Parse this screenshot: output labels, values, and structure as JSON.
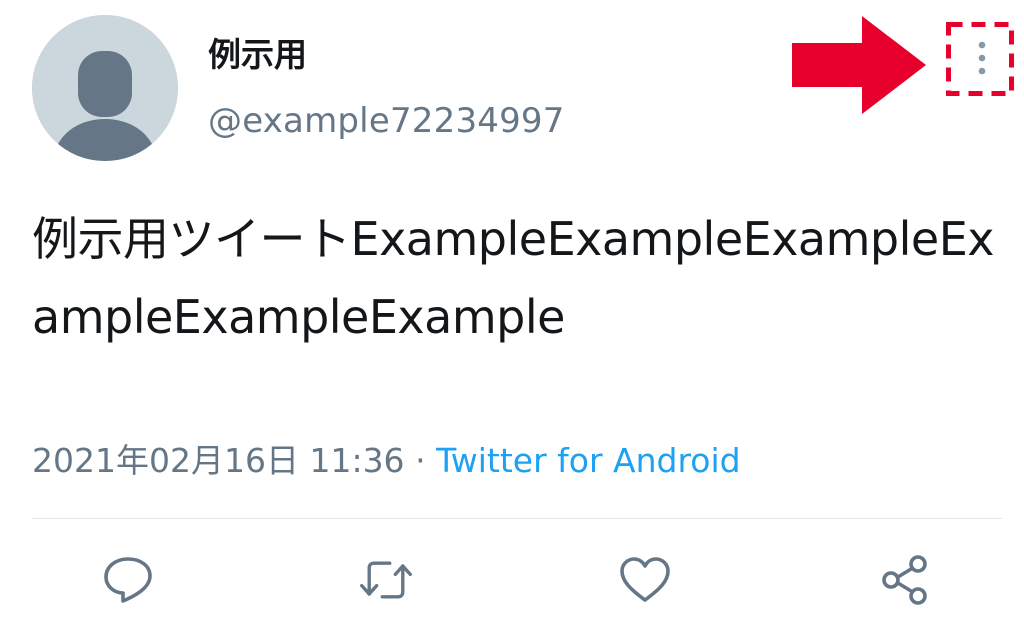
{
  "user": {
    "display_name": "例示用",
    "handle": "@example72234997"
  },
  "tweet": {
    "text": "例示用ツイートExampleExampleExampleExampleExampleExample",
    "timestamp": "2021年02月16日 11:36",
    "separator": "·",
    "source": "Twitter for Android"
  },
  "actions": {
    "reply": "reply-icon",
    "retweet": "retweet-icon",
    "like": "heart-icon",
    "share": "share-icon"
  },
  "icons": {
    "more": "more-vertical-icon",
    "callout": "red-arrow-right-icon"
  },
  "colors": {
    "text": "#14171a",
    "secondary": "#657786",
    "link": "#1da1f2",
    "avatar_bg": "#ccd6dd",
    "avatar_fg": "#657786",
    "highlight": "#e8002d",
    "divider": "#e1e8ed"
  }
}
